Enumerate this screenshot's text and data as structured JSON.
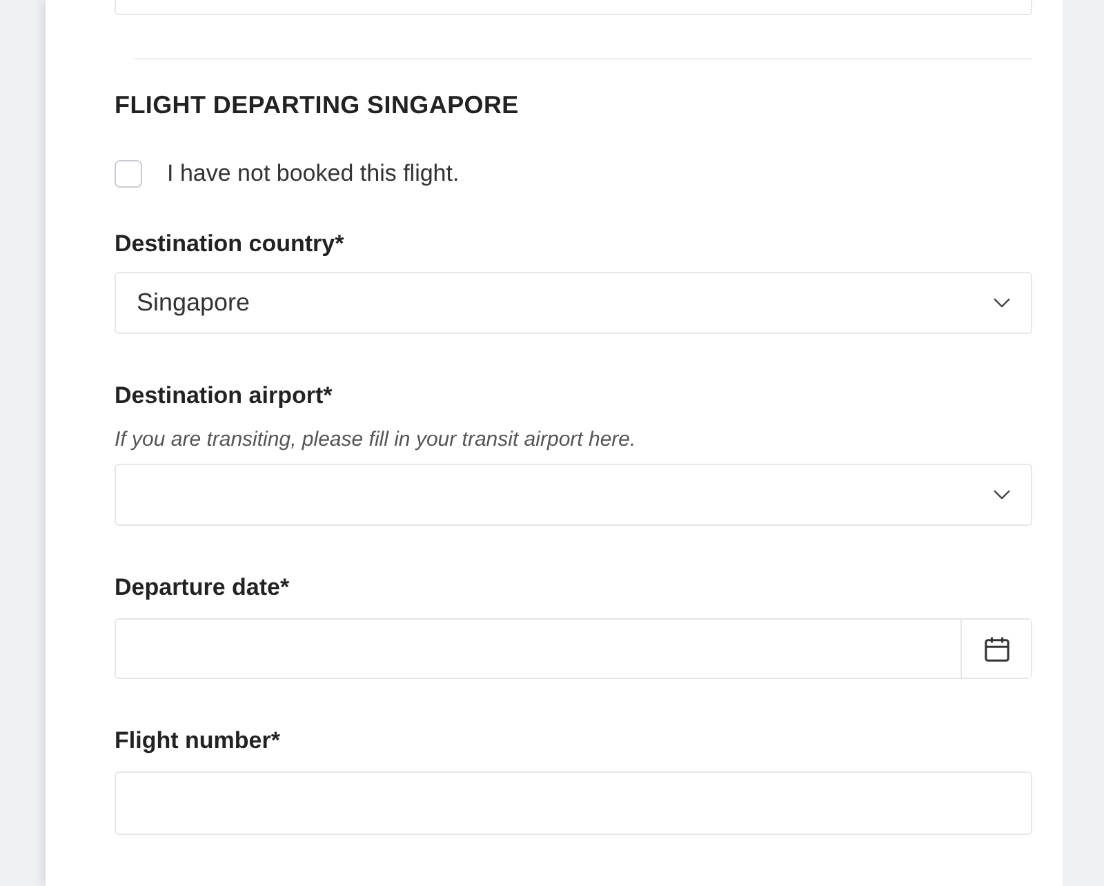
{
  "section": {
    "title": "FLIGHT DEPARTING SINGAPORE"
  },
  "not_booked": {
    "label": "I have not booked this flight.",
    "checked": false
  },
  "fields": [
    {
      "kind": "select",
      "label": "Destination country*",
      "value": "Singapore"
    },
    {
      "kind": "select",
      "label": "Destination airport*",
      "hint": "If you are transiting, please fill in your transit airport here."
    },
    {
      "kind": "date",
      "label": "Departure date*"
    },
    {
      "kind": "text",
      "label": "Flight number*"
    }
  ]
}
